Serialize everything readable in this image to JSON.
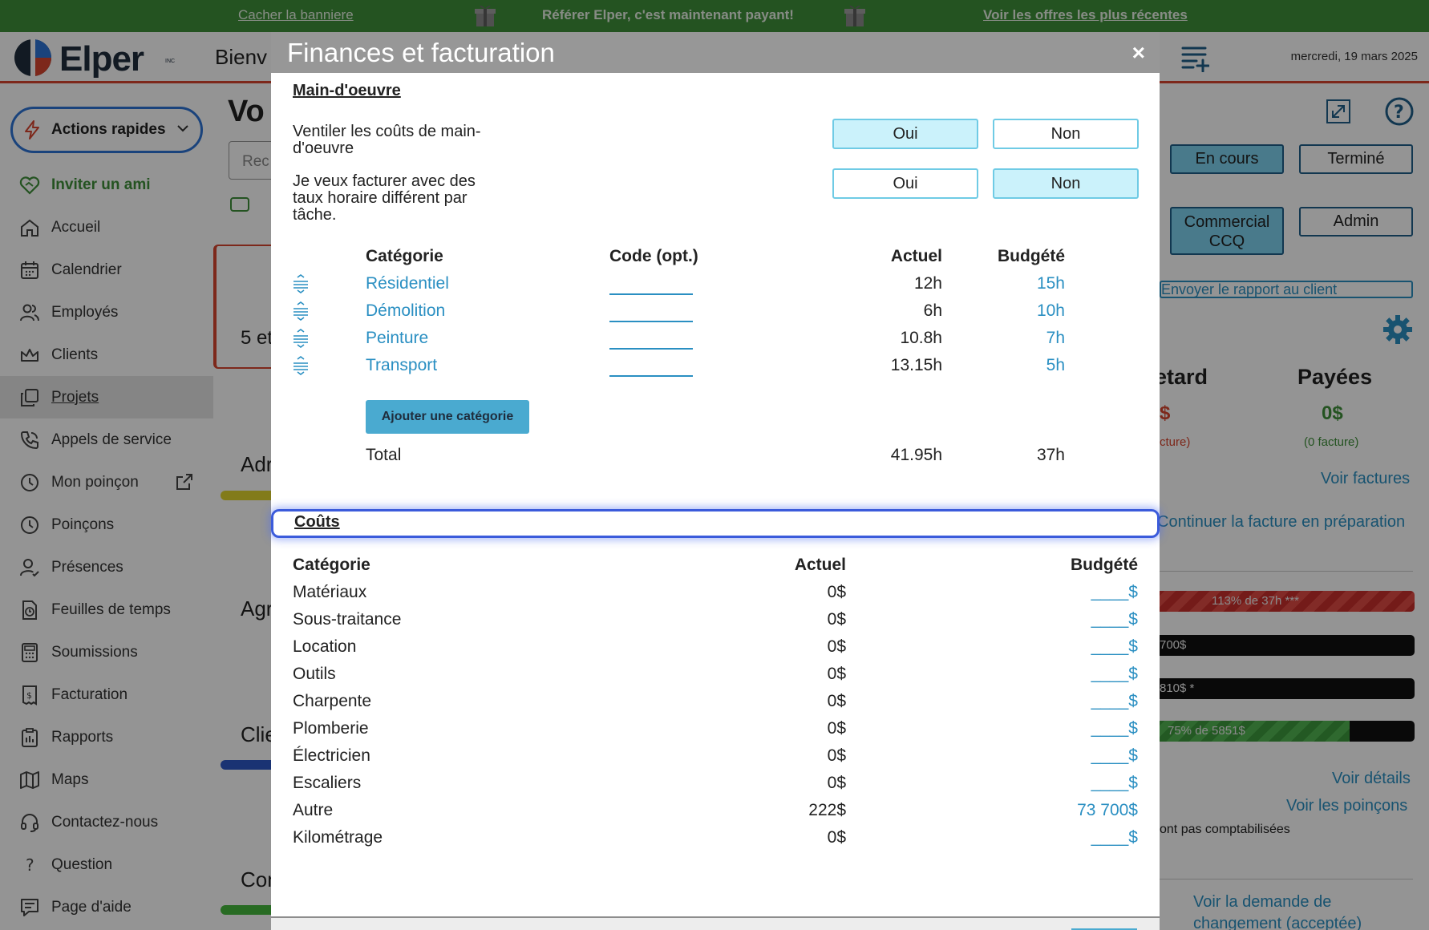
{
  "banner": {
    "hide_label": "Cacher la banniere",
    "promo_text": "Référer Elper, c'est maintenant payant!",
    "offers_label": "Voir les offres les plus récentes"
  },
  "header": {
    "logo_text": "Elper",
    "logo_sup": "INC",
    "welcome_text": "Bienv",
    "date_text": "mercredi, 19 mars 2025"
  },
  "sidebar": {
    "quick_actions_label": "Actions rapides",
    "invite_label": "Inviter un ami",
    "items": [
      {
        "label": "Accueil",
        "icon": "home-icon"
      },
      {
        "label": "Calendrier",
        "icon": "calendar-icon"
      },
      {
        "label": "Employés",
        "icon": "users-icon"
      },
      {
        "label": "Clients",
        "icon": "crown-icon"
      },
      {
        "label": "Projets",
        "icon": "copy-icon"
      },
      {
        "label": "Appels de service",
        "icon": "phone-icon"
      },
      {
        "label": "Mon poinçon",
        "icon": "clock-icon"
      },
      {
        "label": "Poinçons",
        "icon": "clock-icon"
      },
      {
        "label": "Présences",
        "icon": "user-check-icon"
      },
      {
        "label": "Feuilles de temps",
        "icon": "timesheet-icon"
      },
      {
        "label": "Soumissions",
        "icon": "calculator-icon"
      },
      {
        "label": "Facturation",
        "icon": "invoice-icon"
      },
      {
        "label": "Rapports",
        "icon": "clipboard-icon"
      },
      {
        "label": "Maps",
        "icon": "map-icon"
      },
      {
        "label": "Contactez-nous",
        "icon": "headset-icon"
      },
      {
        "label": "Question",
        "icon": "question-icon"
      },
      {
        "label": "Page d'aide",
        "icon": "help-page-icon"
      }
    ]
  },
  "background": {
    "page_title_partial": "Vo",
    "search_placeholder_partial": "Rec",
    "card_text_partial": "5 et",
    "project_labels": [
      "Adr",
      "Agr",
      "Clie",
      "Con"
    ],
    "status_buttons": [
      "En cours",
      "Terminé"
    ],
    "role_buttons": [
      "Commercial CCQ",
      "Admin"
    ],
    "send_report_label": "Envoyer le rapport au client",
    "late_header_partial": "etard",
    "late_value_partial": "$",
    "late_note_partial": "cture)",
    "paid_header": "Payées",
    "paid_value": "0$",
    "paid_note": "(0 facture)",
    "view_invoices": "Voir factures",
    "continue_invoice": "Continuer la facture en préparation",
    "bars": [
      {
        "text": "113%  de  37h  ***",
        "style": "red"
      },
      {
        "text": "700$",
        "style": "dark"
      },
      {
        "text": "810$  *",
        "style": "dark"
      },
      {
        "text": "75%  de  5851$",
        "style": "green",
        "fill": 0.75
      }
    ],
    "view_details": "Voir détails",
    "view_punches": "Voir les poinçons",
    "not_counted_partial": "ont pas comptabilisées",
    "change_request": "Voir la demande de changement (acceptée)"
  },
  "modal": {
    "title": "Finances et facturation",
    "close_symbol": "×",
    "labor_section_title": "Main-d'oeuvre",
    "q1_text": "Ventiler les coûts de main-d'oeuvre",
    "q2_text": "Je veux facturer avec des taux horaire différent par tâche.",
    "yes_label": "Oui",
    "no_label": "Non",
    "q1_selected": "Oui",
    "q2_selected": "Non",
    "labor_headers": {
      "category": "Catégorie",
      "code": "Code (opt.)",
      "actual": "Actuel",
      "budget": "Budgété"
    },
    "labor_rows": [
      {
        "category": "Résidentiel",
        "actual": "12h",
        "budget": "15h"
      },
      {
        "category": "Démolition",
        "actual": "6h",
        "budget": "10h"
      },
      {
        "category": "Peinture",
        "actual": "10.8h",
        "budget": "7h"
      },
      {
        "category": "Transport",
        "actual": "13.15h",
        "budget": "5h"
      }
    ],
    "add_category_label": "Ajouter une catégorie",
    "labor_total_label": "Total",
    "labor_total_actual": "41.95h",
    "labor_total_budget": "37h",
    "costs_section_title": "Coûts",
    "cost_headers": {
      "category": "Catégorie",
      "actual": "Actuel",
      "budget": "Budgété"
    },
    "cost_rows": [
      {
        "category": "Matériaux",
        "actual": "0$",
        "budget": "____$"
      },
      {
        "category": "Sous-traitance",
        "actual": "0$",
        "budget": "____$"
      },
      {
        "category": "Location",
        "actual": "0$",
        "budget": "____$"
      },
      {
        "category": "Outils",
        "actual": "0$",
        "budget": "____$"
      },
      {
        "category": "Charpente",
        "actual": "0$",
        "budget": "____$"
      },
      {
        "category": "Plomberie",
        "actual": "0$",
        "budget": "____$"
      },
      {
        "category": "Électricien",
        "actual": "0$",
        "budget": "____$"
      },
      {
        "category": "Escaliers",
        "actual": "0$",
        "budget": "____$"
      },
      {
        "category": "Autre",
        "actual": "222$",
        "budget": "73 700$"
      },
      {
        "category": "Kilométrage",
        "actual": "0$",
        "budget": "____$"
      }
    ]
  },
  "colors": {
    "banner_green": "#3f8f3a",
    "accent_blue": "#2a8fc2",
    "selected_bg": "#cbf2fb",
    "focus_ring": "#3b5bdb",
    "header_rule": "#d8452f"
  }
}
